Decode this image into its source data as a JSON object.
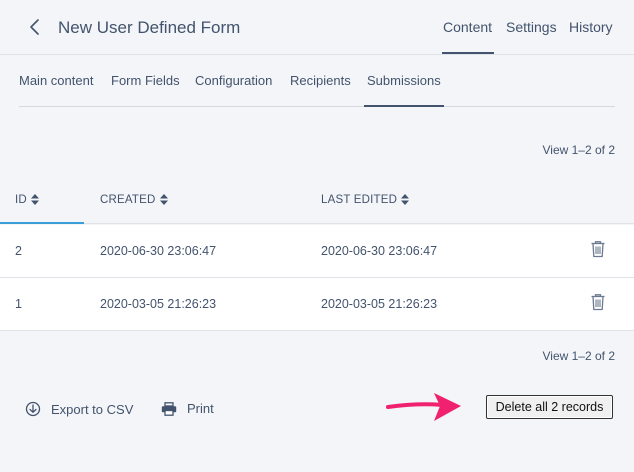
{
  "header": {
    "title": "New User Defined Form",
    "tabs": [
      {
        "label": "Content"
      },
      {
        "label": "Settings"
      },
      {
        "label": "History"
      }
    ]
  },
  "subtabs": [
    {
      "label": "Main content"
    },
    {
      "label": "Form Fields"
    },
    {
      "label": "Configuration"
    },
    {
      "label": "Recipients"
    },
    {
      "label": "Submissions"
    }
  ],
  "pagination": {
    "top": "View 1–2 of 2",
    "bottom": "View 1–2 of 2"
  },
  "table": {
    "columns": [
      {
        "label": "ID"
      },
      {
        "label": "CREATED"
      },
      {
        "label": "LAST EDITED"
      }
    ],
    "rows": [
      {
        "id": "2",
        "created": "2020-06-30 23:06:47",
        "last_edited": "2020-06-30 23:06:47"
      },
      {
        "id": "1",
        "created": "2020-03-05 21:26:23",
        "last_edited": "2020-03-05 21:26:23"
      }
    ]
  },
  "actions": {
    "export_label": "Export to CSV",
    "print_label": "Print",
    "delete_all_label": "Delete all 2 records"
  },
  "colors": {
    "text": "#43536d",
    "accent": "#3a9fd8",
    "arrow": "#f0216e",
    "background": "#f3f5f8"
  }
}
